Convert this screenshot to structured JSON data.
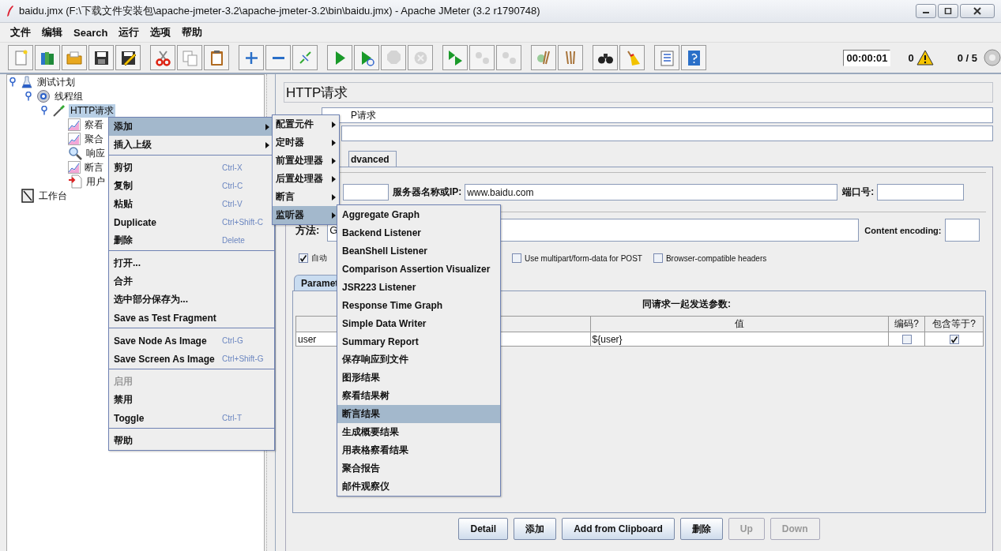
{
  "window": {
    "title": "baidu.jmx (F:\\下载文件安装包\\apache-jmeter-3.2\\apache-jmeter-3.2\\bin\\baidu.jmx) - Apache JMeter (3.2 r1790748)"
  },
  "menu_bar": [
    "文件",
    "编辑",
    "Search",
    "运行",
    "选项",
    "帮助"
  ],
  "toolbar": {
    "groups": [
      {
        "buttons": [
          {
            "disabled": false
          },
          {
            "disabled": false
          },
          {
            "disabled": false
          },
          {
            "disabled": false
          },
          {
            "disabled": false
          }
        ]
      },
      {
        "buttons": [
          {
            "disabled": false
          },
          {
            "disabled": false
          },
          {
            "disabled": false
          }
        ]
      },
      {
        "buttons": [
          {
            "disabled": false
          },
          {
            "disabled": false
          },
          {
            "disabled": false
          }
        ]
      },
      {
        "buttons": [
          {
            "disabled": false
          },
          {
            "disabled": false
          },
          {
            "disabled": true
          },
          {
            "disabled": true
          }
        ]
      },
      {
        "buttons": [
          {
            "disabled": false
          },
          {
            "disabled": true
          },
          {
            "disabled": true
          }
        ]
      },
      {
        "buttons": [
          {
            "disabled": false
          },
          {
            "disabled": false
          }
        ]
      },
      {
        "buttons": [
          {
            "disabled": false
          },
          {
            "disabled": false
          }
        ]
      },
      {
        "buttons": [
          {
            "disabled": false
          },
          {
            "disabled": false
          }
        ]
      }
    ],
    "timer": "00:00:01",
    "errors": "0",
    "threads": "0 / 5"
  },
  "tree": [
    {
      "label": "测试计划",
      "kind": "plan",
      "expanded": true,
      "selected": false,
      "children": [
        {
          "label": "线程组",
          "kind": "thread-group",
          "expanded": true,
          "selected": false,
          "children": [
            {
              "label": "HTTP请求",
              "kind": "sampler",
              "expanded": true,
              "selected": true,
              "children": [
                {
                  "label": "察看",
                  "kind": "graph",
                  "selected": false
                },
                {
                  "label": "聚合",
                  "kind": "graph",
                  "selected": false
                },
                {
                  "label": "响应",
                  "kind": "magnifier",
                  "selected": false
                },
                {
                  "label": "断言",
                  "kind": "graph",
                  "selected": false
                },
                {
                  "label": "用户",
                  "kind": "preprocessor",
                  "selected": false
                }
              ]
            }
          ]
        }
      ]
    },
    {
      "label": "工作台",
      "kind": "workbench",
      "selected": false
    }
  ],
  "editor": {
    "title": "HTTP请求",
    "name_value": "P请求",
    "tab": "dvanced",
    "server_label": "服务器名称或IP:",
    "server_value": "www.baidu.com",
    "port_label": "端口号:",
    "method_label": "方法:",
    "method_value": "G",
    "encoding_label": "Content encoding:",
    "checkboxes": [
      {
        "label": "自动",
        "checked": true
      },
      {
        "label": "Use multipart/form-data for POST",
        "checked": false
      },
      {
        "label": "Browser-compatible headers",
        "checked": false
      }
    ],
    "params_tab": "Paramet",
    "params_heading": "同请求一起发送参数:",
    "table": {
      "columns": [
        "",
        "值",
        "编码?",
        "包含等于?"
      ],
      "rows": [
        {
          "name": "user",
          "value": "${user}",
          "encode": false,
          "include_equals": true
        }
      ]
    },
    "buttons": [
      {
        "label": "Detail",
        "disabled": false
      },
      {
        "label": "添加",
        "disabled": false
      },
      {
        "label": "Add from Clipboard",
        "disabled": false
      },
      {
        "label": "删除",
        "disabled": false
      },
      {
        "label": "Up",
        "disabled": true
      },
      {
        "label": "Down",
        "disabled": true
      }
    ]
  },
  "context_menu": {
    "items": [
      {
        "kind": "item",
        "label": "添加",
        "submenu": true,
        "selected": true,
        "disabled": false
      },
      {
        "kind": "item",
        "label": "插入上级",
        "submenu": true,
        "selected": false,
        "disabled": false
      },
      {
        "kind": "separator"
      },
      {
        "kind": "item",
        "label": "剪切",
        "shortcut": "Ctrl-X",
        "submenu": false,
        "selected": false,
        "disabled": false
      },
      {
        "kind": "item",
        "label": "复制",
        "shortcut": "Ctrl-C",
        "submenu": false,
        "selected": false,
        "disabled": false
      },
      {
        "kind": "item",
        "label": "粘贴",
        "shortcut": "Ctrl-V",
        "submenu": false,
        "selected": false,
        "disabled": false
      },
      {
        "kind": "item",
        "label": "Duplicate",
        "shortcut": "Ctrl+Shift-C",
        "submenu": false,
        "selected": false,
        "disabled": false
      },
      {
        "kind": "item",
        "label": "删除",
        "shortcut": "Delete",
        "submenu": false,
        "selected": false,
        "disabled": false
      },
      {
        "kind": "separator"
      },
      {
        "kind": "item",
        "label": "打开...",
        "submenu": false,
        "selected": false,
        "disabled": false
      },
      {
        "kind": "item",
        "label": "合并",
        "submenu": false,
        "selected": false,
        "disabled": false
      },
      {
        "kind": "item",
        "label": "选中部分保存为...",
        "submenu": false,
        "selected": false,
        "disabled": false
      },
      {
        "kind": "item",
        "label": "Save as Test Fragment",
        "submenu": false,
        "selected": false,
        "disabled": false
      },
      {
        "kind": "separator"
      },
      {
        "kind": "item",
        "label": "Save Node As Image",
        "shortcut": "Ctrl-G",
        "submenu": false,
        "selected": false,
        "disabled": false
      },
      {
        "kind": "item",
        "label": "Save Screen As Image",
        "shortcut": "Ctrl+Shift-G",
        "submenu": false,
        "selected": false,
        "disabled": false
      },
      {
        "kind": "separator"
      },
      {
        "kind": "item",
        "label": "启用",
        "submenu": false,
        "selected": false,
        "disabled": true
      },
      {
        "kind": "item",
        "label": "禁用",
        "submenu": false,
        "selected": false,
        "disabled": false
      },
      {
        "kind": "item",
        "label": "Toggle",
        "shortcut": "Ctrl-T",
        "submenu": false,
        "selected": false,
        "disabled": false
      },
      {
        "kind": "separator"
      },
      {
        "kind": "item",
        "label": "帮助",
        "submenu": false,
        "selected": false,
        "disabled": false
      }
    ]
  },
  "add_submenu": {
    "items": [
      {
        "label": "配置元件",
        "selected": false
      },
      {
        "label": "定时器",
        "selected": false
      },
      {
        "label": "前置处理器",
        "selected": false
      },
      {
        "label": "后置处理器",
        "selected": false
      },
      {
        "label": "断言",
        "selected": false
      },
      {
        "label": "监听器",
        "selected": true
      }
    ]
  },
  "listener_submenu": {
    "items": [
      {
        "label": "Aggregate Graph",
        "selected": false
      },
      {
        "label": "Backend Listener",
        "selected": false
      },
      {
        "label": "BeanShell Listener",
        "selected": false
      },
      {
        "label": "Comparison Assertion Visualizer",
        "selected": false
      },
      {
        "label": "JSR223 Listener",
        "selected": false
      },
      {
        "label": "Response Time Graph",
        "selected": false
      },
      {
        "label": "Simple Data Writer",
        "selected": false
      },
      {
        "label": "Summary Report",
        "selected": false
      },
      {
        "label": "保存响应到文件",
        "selected": false
      },
      {
        "label": "图形结果",
        "selected": false
      },
      {
        "label": "察看结果树",
        "selected": false
      },
      {
        "label": "断言结果",
        "selected": true
      },
      {
        "label": "生成概要结果",
        "selected": false
      },
      {
        "label": "用表格察看结果",
        "selected": false
      },
      {
        "label": "聚合报告",
        "selected": false
      },
      {
        "label": "邮件观察仪",
        "selected": false
      }
    ]
  }
}
